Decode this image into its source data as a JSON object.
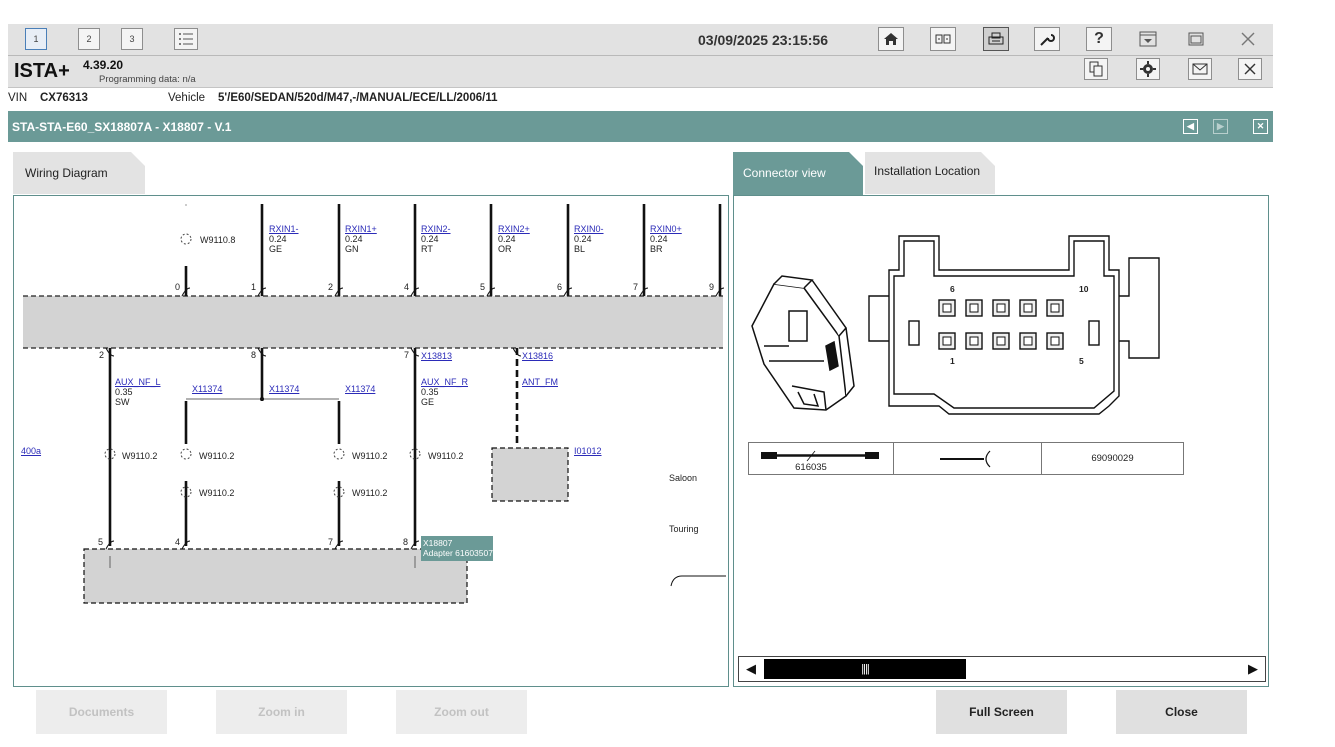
{
  "toolbar": {
    "tabs": [
      "1",
      "2",
      "3"
    ],
    "datetime": "03/09/2025 23:15:56",
    "icons": [
      "list-icon",
      "home-icon",
      "tile-icon",
      "print-icon",
      "wrench-icon",
      "help-icon",
      "dropdown-icon",
      "restore-icon",
      "close-icon"
    ]
  },
  "app": {
    "name": "ISTA+",
    "version": "4.39.20",
    "programming_label": "Programming data:",
    "programming_value": "n/a"
  },
  "vehicle": {
    "vin_label": "VIN",
    "vin": "CX76313",
    "vehicle_label": "Vehicle",
    "vehicle_value": "5'/E60/SEDAN/520d/M47,-/MANUAL/ECE/LL/2006/11"
  },
  "title": "STA-STA-E60_SX18807A - X18807 - V.1",
  "tabs": {
    "wiring": "Wiring Diagram",
    "connector": "Connector view",
    "installation": "Installation Location"
  },
  "diagram": {
    "top_wires": [
      {
        "name": "RXIN1-",
        "size": "0.24",
        "color": "GE"
      },
      {
        "name": "RXIN1+",
        "size": "0.24",
        "color": "GN"
      },
      {
        "name": "RXIN2-",
        "size": "0.24",
        "color": "RT"
      },
      {
        "name": "RXIN2+",
        "size": "0.24",
        "color": "OR"
      },
      {
        "name": "RXIN0-",
        "size": "0.24",
        "color": "BL"
      },
      {
        "name": "RXIN0+",
        "size": "0.24",
        "color": "BR"
      }
    ],
    "top_pins": [
      "0",
      "1",
      "2",
      "4",
      "5",
      "6",
      "7",
      "9"
    ],
    "splice_top": "W9110.8",
    "mid_pins": [
      "2",
      "8",
      "7"
    ],
    "aux_l": {
      "name": "AUX_NF_L",
      "size": "0.35",
      "color": "SW"
    },
    "aux_r": {
      "name": "AUX_NF_R",
      "size": "0.35",
      "color": "GE"
    },
    "x11374": "X11374",
    "x13813": "X13813",
    "x13816": "X13816",
    "ant_fm": "ANT_FM",
    "i01012": "I01012",
    "ref_400a": "400a",
    "splice": "W9110.2",
    "bottom_pins": [
      "5",
      "4",
      "7",
      "8"
    ],
    "tooltip_line1": "X18807",
    "tooltip_line2": "Adapter 61603507",
    "variant_saloon": "Saloon",
    "variant_touring": "Touring"
  },
  "connector": {
    "pin_top_left": "6",
    "pin_top_right": "10",
    "pin_bottom_left": "1",
    "pin_bottom_right": "5",
    "part_cable": "616035",
    "part_number": "69090029"
  },
  "buttons": {
    "documents": "Documents",
    "zoom_in": "Zoom in",
    "zoom_out": "Zoom out",
    "full_screen": "Full Screen",
    "close": "Close"
  }
}
